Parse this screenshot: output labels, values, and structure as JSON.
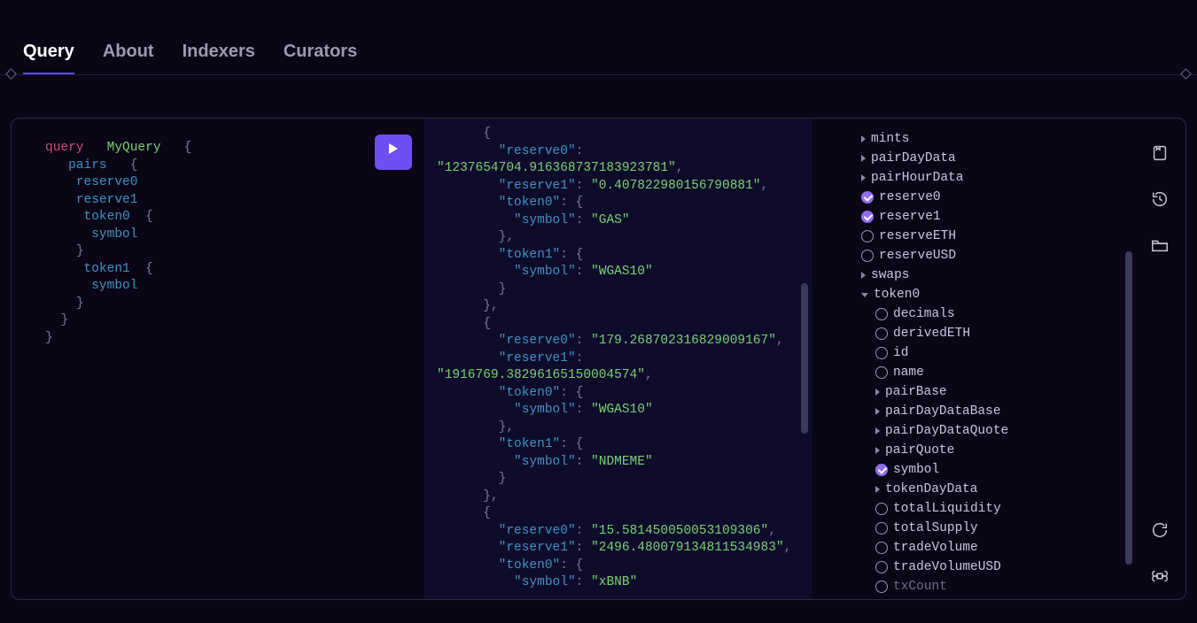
{
  "tabs": {
    "query": "Query",
    "about": "About",
    "indexers": "Indexers",
    "curators": "Curators",
    "active": "query"
  },
  "query_source": {
    "keyword": "query",
    "operation_name": "MyQuery",
    "root_field": "pairs",
    "fields": {
      "reserve0": "reserve0",
      "reserve1": "reserve1",
      "token0": "token0",
      "token1": "token1",
      "symbol": "symbol"
    },
    "brace_open": "{",
    "brace_close": "}"
  },
  "result": {
    "pairs": [
      {
        "reserve0": "1237654704.916368737183923781",
        "reserve1": "0.407822980156790881",
        "token0_symbol": "GAS",
        "token1_symbol": "WGAS10"
      },
      {
        "reserve0": "179.268702316829009167",
        "reserve1": "1916769.38296165150004574",
        "token0_symbol": "WGAS10",
        "token1_symbol": "NDMEME"
      },
      {
        "reserve0": "15.581450050053109306",
        "reserve1": "2496.480079134811534983",
        "token0_symbol": "xBNB"
      }
    ],
    "keys": {
      "reserve0": "reserve0",
      "reserve1": "reserve1",
      "token0": "token0",
      "token1": "token1",
      "symbol": "symbol"
    }
  },
  "explorer": {
    "mints": "mints",
    "pairDayData": "pairDayData",
    "pairHourData": "pairHourData",
    "reserve0": "reserve0",
    "reserve1": "reserve1",
    "reserveETH": "reserveETH",
    "reserveUSD": "reserveUSD",
    "swaps": "swaps",
    "token0": "token0",
    "decimals": "decimals",
    "derivedETH": "derivedETH",
    "id": "id",
    "name": "name",
    "pairBase": "pairBase",
    "pairDayDataBase": "pairDayDataBase",
    "pairDayDataQuote": "pairDayDataQuote",
    "pairQuote": "pairQuote",
    "symbol": "symbol",
    "tokenDayData": "tokenDayData",
    "totalLiquidity": "totalLiquidity",
    "totalSupply": "totalSupply",
    "tradeVolume": "tradeVolume",
    "tradeVolumeUSD": "tradeVolumeUSD",
    "txCount": "txCount"
  },
  "tool_names": {
    "saved": "saved-queries",
    "history": "history",
    "files": "files",
    "refresh": "refresh",
    "shortcuts": "keyboard-shortcuts"
  }
}
